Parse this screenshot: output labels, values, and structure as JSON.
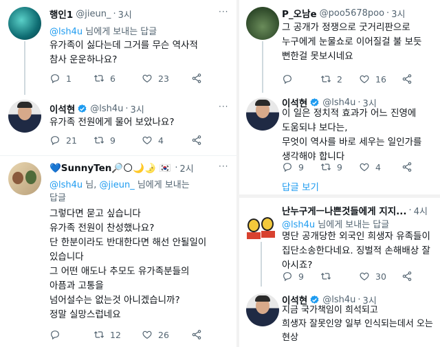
{
  "left": {
    "tweet1": {
      "name": "행인1",
      "handle": "@jieun_",
      "time": "3시",
      "reply_prefix": "@lsh4u",
      "reply_suffix": " 님에게 보내는 답글",
      "text": "유가족이 싫다는데 그거를 무슨 역사적\n참사 운운하나요?",
      "replies": "1",
      "retweets": "6",
      "likes": "23"
    },
    "tweet2": {
      "name": "이석현",
      "handle": "@lsh4u",
      "time": "3시",
      "text": "유가족 전원에게 물어 보았나요?",
      "replies": "21",
      "retweets": "9",
      "likes": "4"
    },
    "tweet3": {
      "name": "💙SunnyTen🔎🌕🌙🌛 🇰🇷",
      "dots": "·",
      "time": "2시",
      "reply_mention1": "@lsh4u",
      "reply_mid": " 님, ",
      "reply_mention2": "@jieun_",
      "reply_suffix": " 님에게 보내는",
      "reply_line2": "답글",
      "text": "그렇다면 묻고 싶습니다\n유가족 전원이 찬성했나요?\n단 한분이라도 반대한다면 해선 안될일이\n있습니다\n그 어떤 애도나 추모도 유가족분들의\n아픔과 고통을\n넘어설수는 없는것 아니겠습니까?\n정말 실망스럽네요",
      "replies": "",
      "retweets": "12",
      "likes": "26"
    }
  },
  "right": {
    "tweet1": {
      "name": "P_오남e",
      "handle": "@poo5678poo",
      "time": "3시",
      "text": "그 공개가 정쟁으로 굿거리판으로\n누구에게 눈물쇼로 이어질걸 불 보듯\n뻔한걸 못보시네요",
      "replies": "",
      "retweets": "2",
      "likes": "16"
    },
    "tweet2": {
      "name": "이석현",
      "handle": "@lsh4u",
      "time": "3시",
      "text": "이 일은 정치적 효과가 어느 진영에\n도움되냐 보다는,\n무엇이 역사를 바로 세우는 일인가를\n생각해야 합니다",
      "replies": "9",
      "retweets": "9",
      "likes": "4",
      "show_replies": "답글 보기"
    },
    "tweet3": {
      "name": "난누구게ㅡ나쁜것들에게 지지...",
      "time": "4시",
      "reply_prefix": "@lsh4u",
      "reply_suffix": " 님에게 보내는 답글",
      "text": "명단 공개당한 외국인 희생자 유족들이\n집단소송한다네요. 징벌적 손해배상 잘\n아시죠?",
      "replies": "9",
      "retweets": "",
      "likes": "30"
    },
    "tweet4": {
      "name": "이석현",
      "handle": "@lsh4u",
      "time": "3시",
      "text": "지금 국가책임이 희석되고\n희생자 잘못인양 일부 인식되는데서 오는\n현상"
    }
  },
  "colors": {
    "accent": "#1d9bf0",
    "secondary_text": "#536471",
    "verified": "#1d9bf0"
  }
}
